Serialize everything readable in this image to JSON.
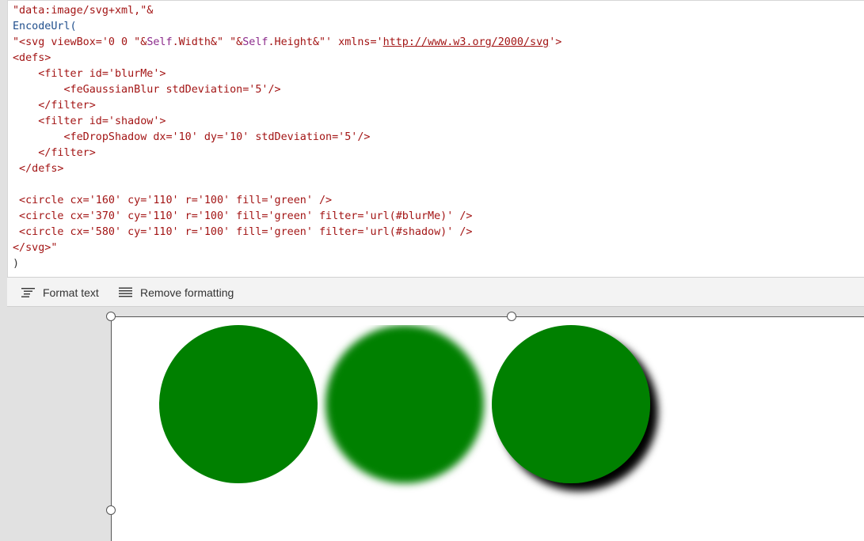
{
  "code_lines": [
    [
      {
        "t": "\"data:image/svg+xml,\"&",
        "c": "s"
      }
    ],
    [
      {
        "t": "EncodeUrl(",
        "c": "f"
      }
    ],
    [
      {
        "t": "\"<svg viewBox='0 0 \"&",
        "c": "s"
      },
      {
        "t": "Self",
        "c": "k"
      },
      {
        "t": ".Width&\" \"&",
        "c": "s"
      },
      {
        "t": "Self",
        "c": "k"
      },
      {
        "t": ".Height&\"' xmlns='",
        "c": "s"
      },
      {
        "t": "http://www.w3.org/2000/svg",
        "c": "u"
      },
      {
        "t": "'>",
        "c": "s"
      }
    ],
    [
      {
        "t": "<defs>",
        "c": "s"
      }
    ],
    [
      {
        "t": "    <filter id='blurMe'>",
        "c": "s"
      }
    ],
    [
      {
        "t": "        <feGaussianBlur stdDeviation='5'/>",
        "c": "s"
      }
    ],
    [
      {
        "t": "    </filter>",
        "c": "s"
      }
    ],
    [
      {
        "t": "    <filter id='shadow'>",
        "c": "s"
      }
    ],
    [
      {
        "t": "        <feDropShadow dx='10' dy='10' stdDeviation='5'/>",
        "c": "s"
      }
    ],
    [
      {
        "t": "    </filter>",
        "c": "s"
      }
    ],
    [
      {
        "t": " </defs>",
        "c": "s"
      }
    ],
    [],
    [
      {
        "t": " <circle cx='160' cy='110' r='100' fill='green' />",
        "c": "s"
      }
    ],
    [
      {
        "t": " <circle cx='370' cy='110' r='100' fill='green' filter='url(#blurMe)' />",
        "c": "s"
      }
    ],
    [
      {
        "t": " <circle cx='580' cy='110' r='100' fill='green' filter='url(#shadow)' />",
        "c": "s"
      }
    ],
    [
      {
        "t": "</svg>\"",
        "c": "s"
      }
    ],
    [
      {
        "t": ")",
        "c": "p"
      }
    ]
  ],
  "toolbar": {
    "format_label": "Format text",
    "remove_label": "Remove formatting"
  },
  "colors": {
    "circle_fill": "#008000"
  },
  "icons": {
    "format": "format-text-icon",
    "remove": "remove-formatting-icon"
  }
}
